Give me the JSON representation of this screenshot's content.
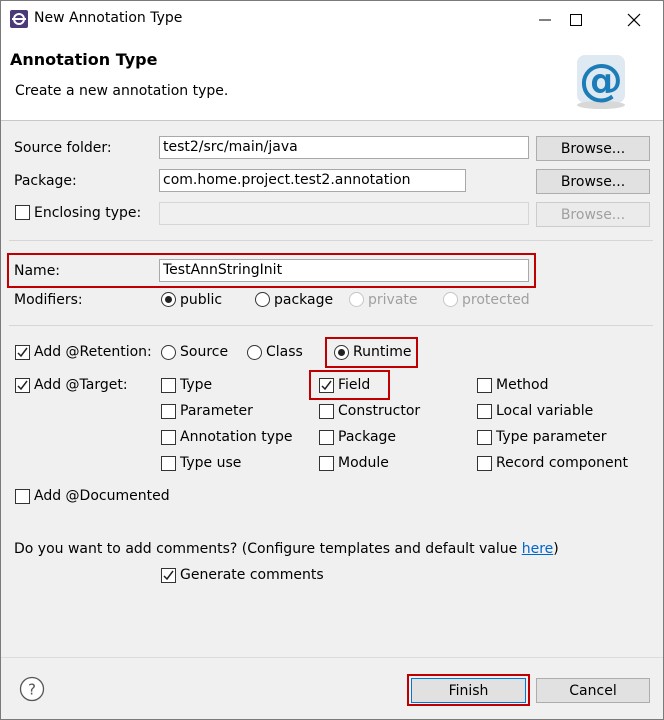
{
  "window": {
    "title": "New Annotation Type"
  },
  "header": {
    "title": "Annotation Type",
    "subtitle": "Create a new annotation type."
  },
  "form": {
    "source_folder_label": "Source folder:",
    "source_folder_value": "test2/src/main/java",
    "package_label": "Package:",
    "package_value": "com.home.project.test2.annotation",
    "enclosing_label": "Enclosing type:",
    "enclosing_value": "",
    "browse_label": "Browse...",
    "name_label": "Name:",
    "name_value": "TestAnnStringInit",
    "modifiers_label": "Modifiers:",
    "modifiers": [
      "public",
      "package",
      "private",
      "protected"
    ],
    "modifier_selected": "public"
  },
  "retention": {
    "label": "Add @Retention:",
    "checked": true,
    "options": [
      "Source",
      "Class",
      "Runtime"
    ],
    "selected": "Runtime"
  },
  "target": {
    "label": "Add @Target:",
    "checked": true,
    "options": [
      "Type",
      "Field",
      "Method",
      "Parameter",
      "Constructor",
      "Local variable",
      "Annotation type",
      "Package",
      "Type parameter",
      "Type use",
      "Module",
      "Record component"
    ],
    "checked_options": [
      "Field"
    ]
  },
  "documented": {
    "label": "Add @Documented",
    "checked": false
  },
  "comments": {
    "question": "Do you want to add comments? (Configure templates and default value ",
    "link": "here",
    "close": ")",
    "generate_label": "Generate comments",
    "generate_checked": true
  },
  "footer": {
    "finish_label": "Finish",
    "cancel_label": "Cancel"
  },
  "icons": {
    "help": "help-icon",
    "app": "eclipse-icon",
    "banner": "annotation-at-icon"
  },
  "colors": {
    "highlight": "#c00000",
    "link": "#0066cc",
    "banner_icon": "#1c7cb8"
  }
}
